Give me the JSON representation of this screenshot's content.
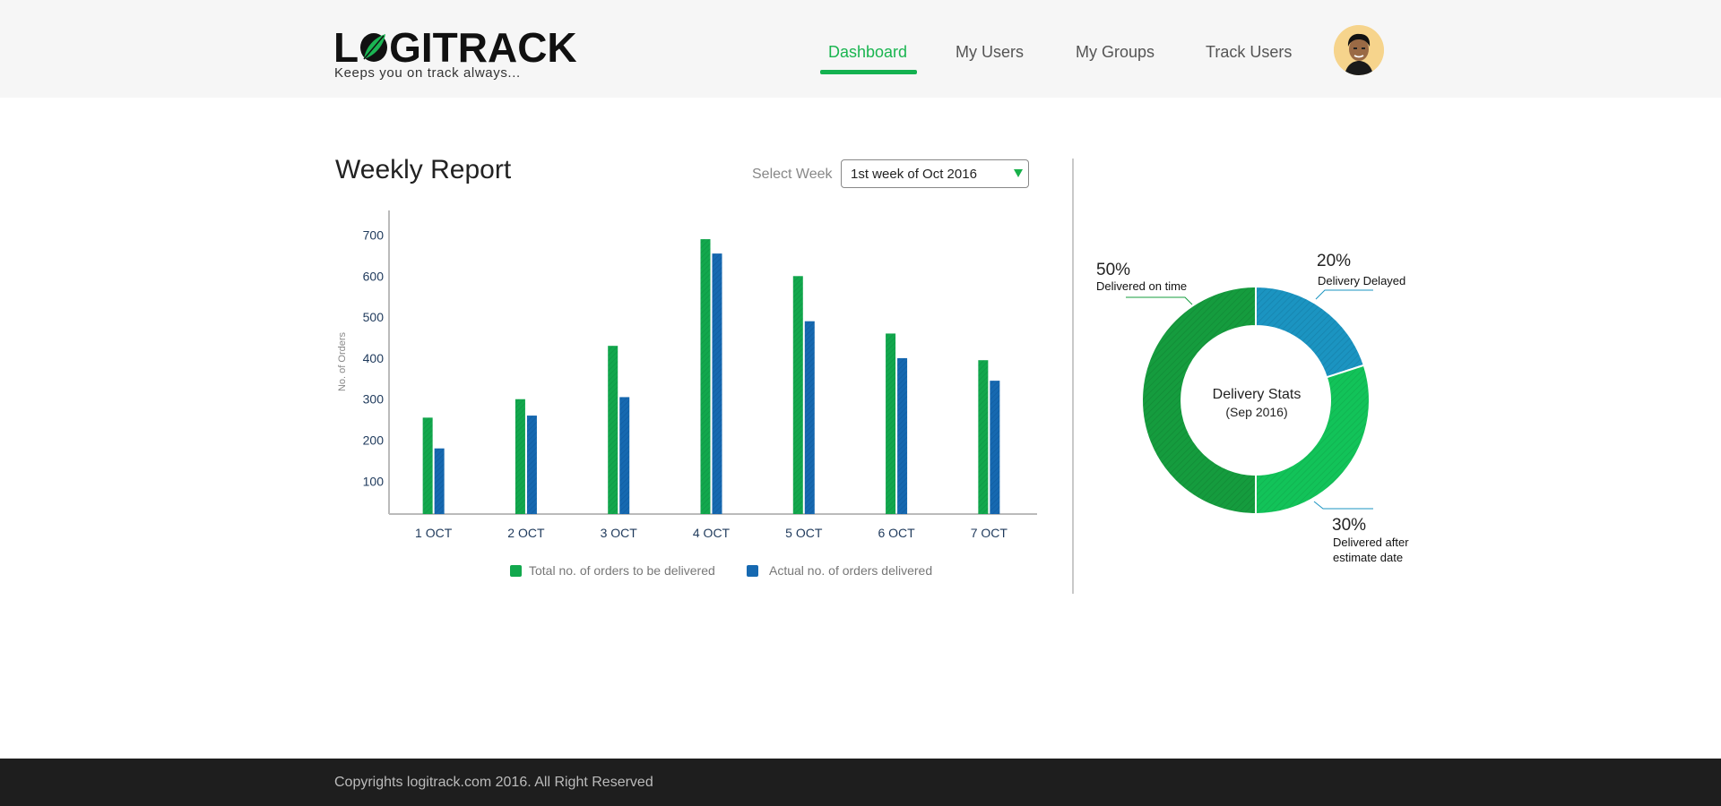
{
  "brand": {
    "logo_text_left": "L",
    "logo_text_right": "GITRACK",
    "tagline": "Keeps you on track always..."
  },
  "nav": {
    "items": [
      {
        "label": "Dashboard",
        "active": true
      },
      {
        "label": "My Users",
        "active": false
      },
      {
        "label": "My Groups",
        "active": false
      },
      {
        "label": "Track Users",
        "active": false
      }
    ]
  },
  "report": {
    "title": "Weekly Report",
    "select_label": "Select Week",
    "select_value": "1st week of Oct 2016"
  },
  "colors": {
    "accent": "#14b150",
    "bar_total": "#12a84d",
    "bar_actual": "#1669b1",
    "donut_on_time": "#159c3e",
    "donut_delayed": "#1b94c1",
    "donut_after": "#12c359"
  },
  "chart_data": [
    {
      "type": "bar",
      "ylabel": "No. of Orders",
      "xlabel": "",
      "categories": [
        "1 OCT",
        "2 OCT",
        "3 OCT",
        "4 OCT",
        "5 OCT",
        "6 OCT",
        "7 OCT"
      ],
      "series": [
        {
          "name": "Total no. of orders to be delivered",
          "values": [
            255,
            300,
            430,
            690,
            600,
            460,
            395
          ]
        },
        {
          "name": "Actual no. of orders delivered",
          "values": [
            180,
            260,
            305,
            655,
            490,
            400,
            345
          ]
        }
      ],
      "yticks": [
        100,
        200,
        300,
        400,
        500,
        600,
        700
      ],
      "ylim": [
        20,
        760
      ],
      "legend_position": "bottom",
      "grid": false
    },
    {
      "type": "pie",
      "variant": "donut",
      "title": "Delivery Stats",
      "subtitle": "(Sep 2016)",
      "slices": [
        {
          "percent_label": "20%",
          "label": "Delivery Delayed",
          "value": 20
        },
        {
          "percent_label": "30%",
          "label_line1": "Delivered after",
          "label_line2": "estimate date",
          "value": 30
        },
        {
          "percent_label": "50%",
          "label": "Delivered on time",
          "value": 50
        }
      ]
    }
  ],
  "footer": {
    "text": "Copyrights logitrack.com 2016. All Right Reserved"
  }
}
